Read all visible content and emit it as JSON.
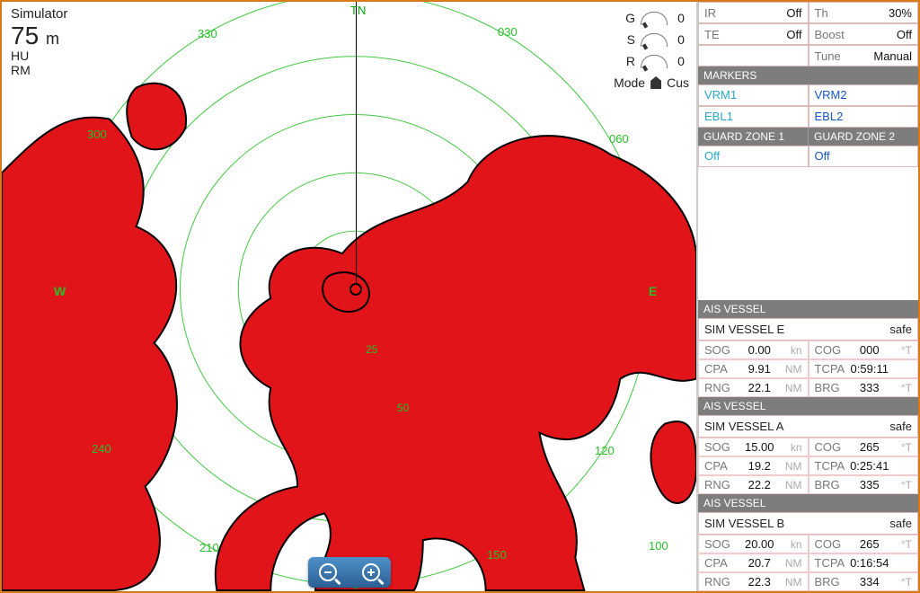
{
  "status": {
    "label": "Simulator",
    "range_value": "75",
    "range_unit": "m",
    "orientation": "HU",
    "motion": "RM"
  },
  "bearings": {
    "TN": "TN",
    "030": "030",
    "060": "060",
    "E": "E",
    "120": "120",
    "150": "150",
    "S": "S",
    "210": "210",
    "240": "240",
    "W": "W",
    "300": "300",
    "330": "330",
    "100": "100"
  },
  "rings": {
    "r25": "25",
    "r50": "50"
  },
  "controls": {
    "G": {
      "label": "G",
      "value": "0"
    },
    "S": {
      "label": "S",
      "value": "0"
    },
    "R": {
      "label": "R",
      "value": "0"
    },
    "mode": {
      "label": "Mode",
      "value": "Cus"
    }
  },
  "settings": {
    "IR": {
      "label": "IR",
      "value": "Off"
    },
    "TE": {
      "label": "TE",
      "value": "Off"
    },
    "blank": {
      "label": "",
      "value": ""
    },
    "Th": {
      "label": "Th",
      "value": "30%"
    },
    "Boost": {
      "label": "Boost",
      "value": "Off"
    },
    "Tune": {
      "label": "Tune",
      "value": "Manual"
    }
  },
  "markers": {
    "header": "MARKERS",
    "VRM1": "VRM1",
    "VRM2": "VRM2",
    "EBL1": "EBL1",
    "EBL2": "EBL2"
  },
  "guard": {
    "h1": "GUARD ZONE 1",
    "h2": "GUARD ZONE 2",
    "v1": "Off",
    "v2": "Off"
  },
  "vessels": [
    {
      "title": "AIS VESSEL",
      "name": "SIM VESSEL E",
      "status": "safe",
      "rows": [
        {
          "a": {
            "k": "SOG",
            "v": "0.00",
            "u": "kn"
          },
          "b": {
            "k": "COG",
            "v": "000",
            "u": "°T"
          }
        },
        {
          "a": {
            "k": "CPA",
            "v": "9.91",
            "u": "NM"
          },
          "b": {
            "k": "TCPA",
            "v": "0:59:11",
            "u": ""
          }
        },
        {
          "a": {
            "k": "RNG",
            "v": "22.1",
            "u": "NM"
          },
          "b": {
            "k": "BRG",
            "v": "333",
            "u": "°T"
          }
        }
      ]
    },
    {
      "title": "AIS VESSEL",
      "name": "SIM VESSEL A",
      "status": "safe",
      "rows": [
        {
          "a": {
            "k": "SOG",
            "v": "15.00",
            "u": "kn"
          },
          "b": {
            "k": "COG",
            "v": "265",
            "u": "°T"
          }
        },
        {
          "a": {
            "k": "CPA",
            "v": "19.2",
            "u": "NM"
          },
          "b": {
            "k": "TCPA",
            "v": "0:25:41",
            "u": ""
          }
        },
        {
          "a": {
            "k": "RNG",
            "v": "22.2",
            "u": "NM"
          },
          "b": {
            "k": "BRG",
            "v": "335",
            "u": "°T"
          }
        }
      ]
    },
    {
      "title": "AIS VESSEL",
      "name": "SIM VESSEL B",
      "status": "safe",
      "rows": [
        {
          "a": {
            "k": "SOG",
            "v": "20.00",
            "u": "kn"
          },
          "b": {
            "k": "COG",
            "v": "265",
            "u": "°T"
          }
        },
        {
          "a": {
            "k": "CPA",
            "v": "20.7",
            "u": "NM"
          },
          "b": {
            "k": "TCPA",
            "v": "0:16:54",
            "u": ""
          }
        },
        {
          "a": {
            "k": "RNG",
            "v": "22.3",
            "u": "NM"
          },
          "b": {
            "k": "BRG",
            "v": "334",
            "u": "°T"
          }
        }
      ]
    }
  ]
}
